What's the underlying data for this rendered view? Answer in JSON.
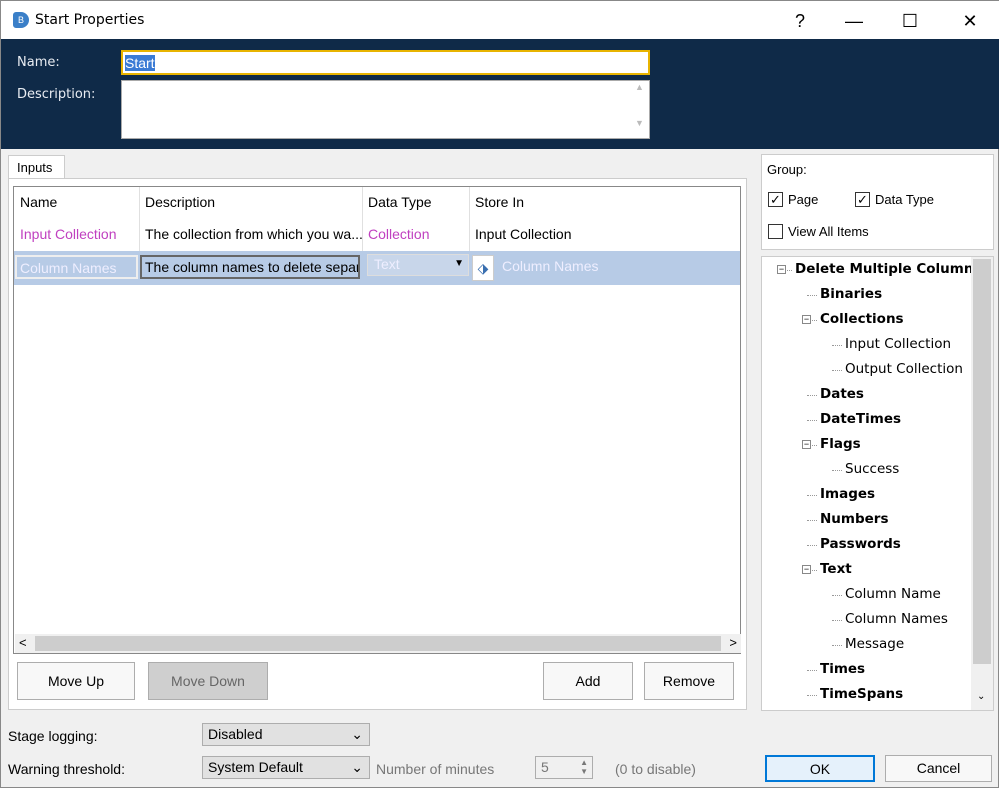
{
  "window": {
    "title": "Start Properties",
    "help": "?",
    "minimize": "—",
    "maximize": "☐",
    "close": "✕"
  },
  "header": {
    "name_label": "Name:",
    "name_value": "Start",
    "description_label": "Description:",
    "description_value": ""
  },
  "tabs": [
    {
      "label": "Inputs"
    }
  ],
  "grid": {
    "columns": [
      "Name",
      "Description",
      "Data Type",
      "Store In"
    ],
    "rows": [
      {
        "name": "Input Collection",
        "description": "The collection from which you wa...",
        "data_type": "Collection",
        "store_in": "Input Collection"
      },
      {
        "name": "Column Names",
        "description": "The column names to delete separat",
        "data_type": "Text",
        "store_in": "Column Names"
      }
    ],
    "scroll_left": "<",
    "scroll_right": ">"
  },
  "buttons": {
    "move_up": "Move Up",
    "move_down": "Move Down",
    "add": "Add",
    "remove": "Remove",
    "ok": "OK",
    "cancel": "Cancel"
  },
  "group": {
    "label": "Group:",
    "page": "Page",
    "data_type": "Data Type",
    "view_all": "View All Items",
    "page_checked": true,
    "data_type_checked": true,
    "view_all_checked": false
  },
  "tree": [
    {
      "label": "Delete Multiple Columns",
      "level": 0,
      "bold": true,
      "expander": "⊟"
    },
    {
      "label": "Binaries",
      "level": 1,
      "bold": true
    },
    {
      "label": "Collections",
      "level": 1,
      "bold": true,
      "expander": "⊟"
    },
    {
      "label": "Input Collection",
      "level": 2,
      "bold": false
    },
    {
      "label": "Output Collection",
      "level": 2,
      "bold": false
    },
    {
      "label": "Dates",
      "level": 1,
      "bold": true
    },
    {
      "label": "DateTimes",
      "level": 1,
      "bold": true
    },
    {
      "label": "Flags",
      "level": 1,
      "bold": true,
      "expander": "⊟"
    },
    {
      "label": "Success",
      "level": 2,
      "bold": false
    },
    {
      "label": "Images",
      "level": 1,
      "bold": true
    },
    {
      "label": "Numbers",
      "level": 1,
      "bold": true
    },
    {
      "label": "Passwords",
      "level": 1,
      "bold": true
    },
    {
      "label": "Text",
      "level": 1,
      "bold": true,
      "expander": "⊟"
    },
    {
      "label": "Column Name",
      "level": 2,
      "bold": false
    },
    {
      "label": "Column Names",
      "level": 2,
      "bold": false
    },
    {
      "label": "Message",
      "level": 2,
      "bold": false
    },
    {
      "label": "Times",
      "level": 1,
      "bold": true
    },
    {
      "label": "TimeSpans",
      "level": 1,
      "bold": true
    }
  ],
  "footer": {
    "stage_logging_label": "Stage logging:",
    "stage_logging_value": "Disabled",
    "warning_label": "Warning threshold:",
    "warning_value": "System Default",
    "minutes_label": "Number of minutes",
    "minutes_value": "5",
    "disable_hint": "(0 to disable)"
  },
  "colors": {
    "header": "#0f2a48",
    "selection": "#b7cbe6",
    "purple": "#c040c0"
  }
}
